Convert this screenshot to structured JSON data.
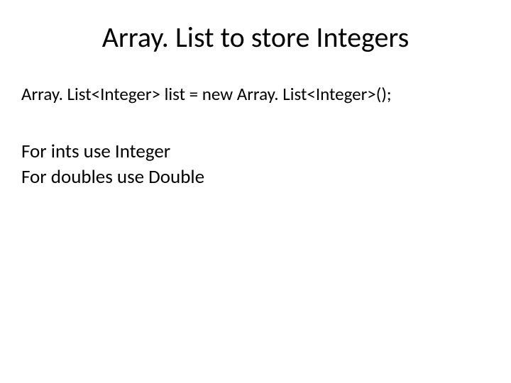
{
  "slide": {
    "title": "Array. List to store Integers",
    "code_declaration": "Array. List<Integer> list = new Array. List<Integer>();",
    "body": {
      "line1": "For ints use Integer",
      "line2": "For doubles use Double"
    }
  }
}
